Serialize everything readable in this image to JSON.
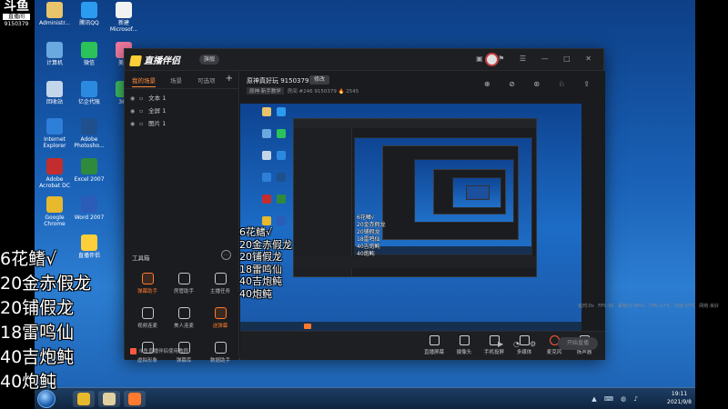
{
  "streamer_logo": {
    "mark": "斗鱼",
    "tag": "直播间",
    "room_id": "9150379"
  },
  "desktop_icons": [
    {
      "label": "Administr...",
      "color": "#e8c46a"
    },
    {
      "label": "腾讯QQ",
      "color": "#2b9bf0"
    },
    {
      "label": "新建 Microsof...",
      "color": "#f2f2f2"
    },
    {
      "label": "计算机",
      "color": "#6aa8e0"
    },
    {
      "label": "微信",
      "color": "#2bc25a"
    },
    {
      "label": "美颜",
      "color": "#f07aa0"
    },
    {
      "label": "回收站",
      "color": "#c4d6ea"
    },
    {
      "label": "亿企代账",
      "color": "#2b8ae0"
    },
    {
      "label": "360",
      "color": "#3fbf62"
    },
    {
      "label": "Internet Explorer",
      "color": "#2d7fd8"
    },
    {
      "label": "Adobe Photosho...",
      "color": "#1f4f8c"
    },
    {
      "label": "Adobe Acrobat DC",
      "color": "#c42d2d"
    },
    {
      "label": "Excel 2007",
      "color": "#2f8a3c"
    },
    {
      "label": "Google Chrome",
      "color": "#e8b82d"
    },
    {
      "label": "Word 2007",
      "color": "#2b5cb8"
    },
    {
      "label": "直播伴侣",
      "color": "#ffcf3a"
    }
  ],
  "taskbar": {
    "apps": [
      {
        "name": "chrome",
        "color": "#e8b82d"
      },
      {
        "name": "game",
        "color": "#e0d2a0"
      },
      {
        "name": "live",
        "color": "#ff7a2e"
      }
    ],
    "tray_icons": "▲ ⌨ ◍ ♪",
    "time": "19:11",
    "date": "2021/9/8"
  },
  "app": {
    "brand": "直播伴侣",
    "version": "旗舰",
    "window_buttons": "▣ ⚑ ☰ — □ ✕",
    "tabs": [
      "我的场景",
      "场景",
      "可选项"
    ],
    "sources": [
      {
        "label": "文本 1"
      },
      {
        "label": "全屏 1"
      },
      {
        "label": "图片 1"
      }
    ],
    "tools_title": "工具箱",
    "tools": [
      {
        "label": "弹幕助手",
        "hot": true
      },
      {
        "label": "房管助手",
        "hot": false
      },
      {
        "label": "主播任务",
        "hot": false
      },
      {
        "label": "视频连麦",
        "hot": false
      },
      {
        "label": "美人连麦",
        "hot": false
      },
      {
        "label": "送弹幕",
        "hot": true
      },
      {
        "label": "虚拟形象",
        "hot": false
      },
      {
        "label": "弹幕库",
        "hot": false
      },
      {
        "label": "数据助手",
        "hot": false
      }
    ],
    "notice": "斗鱼直播伴侣使用教程",
    "room": {
      "title": "原神真好玩 9150379",
      "edit": "修改",
      "category": "原神·新手教学",
      "meta": "房间 #246 9150379 🔥 2545"
    },
    "top_icons": "⊕ ⊘ ⊛ ♘ ⇪",
    "bottom_buttons": [
      {
        "label": "直播屏幕",
        "icon": "screen-icon"
      },
      {
        "label": "摄像头",
        "icon": "camera-icon"
      },
      {
        "label": "手机投屏",
        "icon": "phone-icon"
      },
      {
        "label": "多媒体",
        "icon": "media-icon"
      },
      {
        "label": "麦克风",
        "icon": "mic-icon"
      },
      {
        "label": "扬声器",
        "icon": "speaker-icon"
      }
    ],
    "live_button": "开始直播",
    "status": "延时:0s   FPS:30   丢包(0.00%)   CPU:17%   内存:37%   网络:良好"
  },
  "overlay_text": [
    "6花鳍√",
    "20金赤假龙",
    "20铺假龙",
    "18雷鸣仙",
    "40吉炮鲀",
    "40炮鲀"
  ]
}
